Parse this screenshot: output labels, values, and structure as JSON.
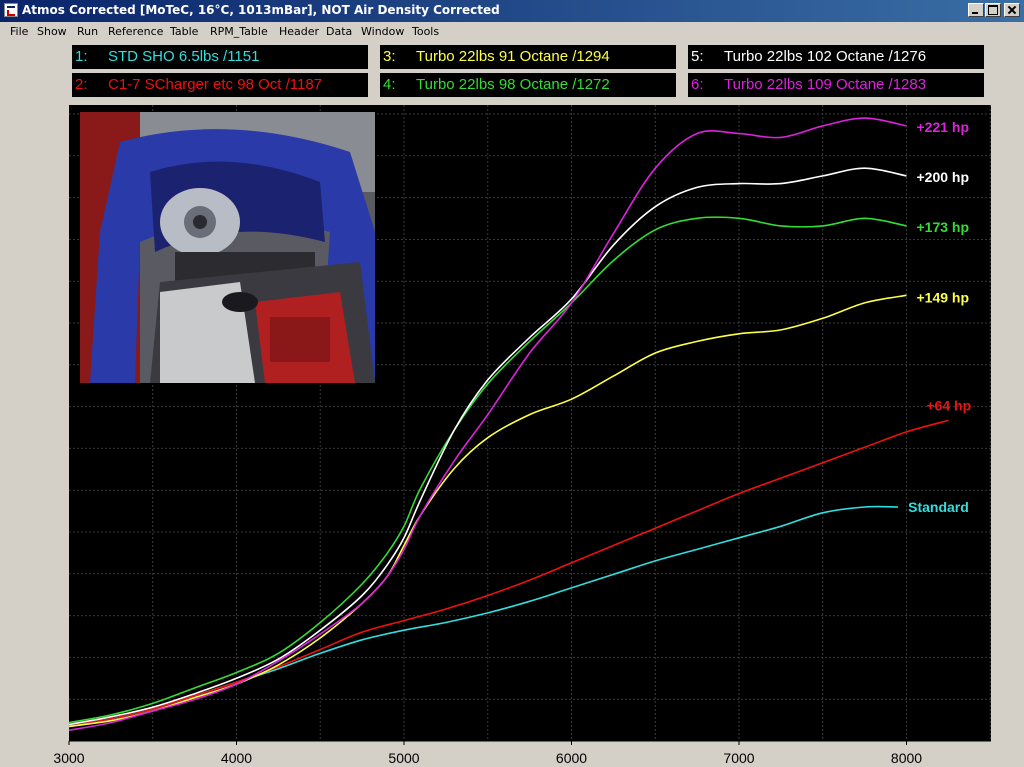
{
  "window": {
    "title": "Atmos Corrected [MoTeC, 16°C, 1013mBar], NOT Air Density Corrected"
  },
  "menu": {
    "items": [
      "File",
      "Show",
      "Run",
      "Reference",
      "Table",
      "RPM_Table",
      "Header",
      "Data",
      "Window",
      "Tools"
    ]
  },
  "legend": [
    {
      "num": "1:",
      "label": "STD SHO 6.5lbs /1151",
      "color": "#33dddd"
    },
    {
      "num": "2:",
      "label": "C1-7 SCharger etc 98 Oct /1187",
      "color": "#ee1111"
    },
    {
      "num": "3:",
      "label": "Turbo 22lbs 91 Octane /1294",
      "color": "#ffff44"
    },
    {
      "num": "4:",
      "label": "Turbo 22lbs 98 Octane /1272",
      "color": "#33dd33"
    },
    {
      "num": "5:",
      "label": "Turbo 22lbs 102 Octane /1276",
      "color": "#ffffff"
    },
    {
      "num": "6:",
      "label": "Turbo 22lbs 109 Octane /1283",
      "color": "#dd22dd"
    }
  ],
  "chart_data": {
    "type": "line",
    "xlim": [
      3000,
      8500
    ],
    "ylim": [
      0,
      100
    ],
    "x_ticks": [
      3000,
      4000,
      5000,
      6000,
      7000,
      8000
    ],
    "grid": true,
    "series": [
      {
        "name": "STD SHO 6.5lbs /1151",
        "color": "#33dddd",
        "end_label": "Standard",
        "points": [
          [
            3000,
            3
          ],
          [
            3250,
            5
          ],
          [
            3500,
            7.5
          ],
          [
            3750,
            11
          ],
          [
            4000,
            14.5
          ],
          [
            4250,
            18
          ],
          [
            4500,
            22
          ],
          [
            4750,
            25.5
          ],
          [
            5000,
            28
          ],
          [
            5250,
            30
          ],
          [
            5500,
            32.5
          ],
          [
            5750,
            35.5
          ],
          [
            6000,
            39
          ],
          [
            6250,
            42.5
          ],
          [
            6500,
            46
          ],
          [
            6750,
            49
          ],
          [
            7000,
            52
          ],
          [
            7250,
            55
          ],
          [
            7500,
            58.5
          ],
          [
            7750,
            60
          ],
          [
            7950,
            60
          ]
        ]
      },
      {
        "name": "C1-7 SCharger etc 98 Oct /1187",
        "color": "#ee1111",
        "end_label": "+64 hp",
        "points": [
          [
            3000,
            3
          ],
          [
            3250,
            5
          ],
          [
            3500,
            7.5
          ],
          [
            3750,
            11
          ],
          [
            4000,
            14.5
          ],
          [
            4250,
            18.5
          ],
          [
            4500,
            23
          ],
          [
            4750,
            27.5
          ],
          [
            5000,
            30.5
          ],
          [
            5250,
            33.5
          ],
          [
            5500,
            37
          ],
          [
            5750,
            41
          ],
          [
            6000,
            45.5
          ],
          [
            6250,
            50
          ],
          [
            6500,
            54.5
          ],
          [
            6750,
            59
          ],
          [
            7000,
            63.5
          ],
          [
            7250,
            67.5
          ],
          [
            7500,
            71.5
          ],
          [
            7750,
            75.5
          ],
          [
            8000,
            79.5
          ],
          [
            8250,
            82.5
          ]
        ]
      },
      {
        "name": "Turbo 22lbs 91 Octane /1294",
        "color": "#ffff44",
        "end_label": "+149 hp",
        "points": [
          [
            3000,
            3
          ],
          [
            3250,
            4.5
          ],
          [
            3500,
            7
          ],
          [
            3750,
            10.5
          ],
          [
            4000,
            14
          ],
          [
            4250,
            19
          ],
          [
            4500,
            26
          ],
          [
            4750,
            35
          ],
          [
            4900,
            42
          ],
          [
            5000,
            50
          ],
          [
            5100,
            58
          ],
          [
            5300,
            70
          ],
          [
            5500,
            78
          ],
          [
            5750,
            84
          ],
          [
            6000,
            88
          ],
          [
            6250,
            94
          ],
          [
            6500,
            100
          ],
          [
            6750,
            103
          ],
          [
            7000,
            105
          ],
          [
            7250,
            106
          ],
          [
            7500,
            109
          ],
          [
            7750,
            113
          ],
          [
            8000,
            115
          ]
        ]
      },
      {
        "name": "Turbo 22lbs 98 Octane /1272",
        "color": "#33dd33",
        "end_label": "+173 hp",
        "points": [
          [
            3000,
            4
          ],
          [
            3250,
            6
          ],
          [
            3500,
            9
          ],
          [
            3750,
            13
          ],
          [
            4000,
            17
          ],
          [
            4250,
            22
          ],
          [
            4500,
            30
          ],
          [
            4750,
            40
          ],
          [
            4900,
            48
          ],
          [
            5000,
            55
          ],
          [
            5100,
            65
          ],
          [
            5300,
            80
          ],
          [
            5500,
            92
          ],
          [
            5750,
            103
          ],
          [
            6000,
            113
          ],
          [
            6250,
            124
          ],
          [
            6500,
            132
          ],
          [
            6750,
            135
          ],
          [
            7000,
            135
          ],
          [
            7250,
            133
          ],
          [
            7500,
            133
          ],
          [
            7750,
            135
          ],
          [
            8000,
            133
          ]
        ]
      },
      {
        "name": "Turbo 22lbs 102 Octane /1276",
        "color": "#ffffff",
        "end_label": "+200 hp",
        "points": [
          [
            3000,
            3.5
          ],
          [
            3250,
            5.5
          ],
          [
            3500,
            8
          ],
          [
            3750,
            11.5
          ],
          [
            4000,
            15.5
          ],
          [
            4250,
            20.5
          ],
          [
            4500,
            28
          ],
          [
            4750,
            37
          ],
          [
            4900,
            45
          ],
          [
            5000,
            52
          ],
          [
            5100,
            62
          ],
          [
            5300,
            80
          ],
          [
            5500,
            93
          ],
          [
            5750,
            104
          ],
          [
            6000,
            114
          ],
          [
            6250,
            128
          ],
          [
            6500,
            138
          ],
          [
            6750,
            143
          ],
          [
            7000,
            144
          ],
          [
            7250,
            144
          ],
          [
            7500,
            146
          ],
          [
            7750,
            148
          ],
          [
            8000,
            146
          ]
        ]
      },
      {
        "name": "Turbo 22lbs 109 Octane /1283",
        "color": "#dd22dd",
        "end_label": "+221 hp",
        "points": [
          [
            3000,
            2
          ],
          [
            3250,
            4
          ],
          [
            3500,
            7
          ],
          [
            3750,
            10
          ],
          [
            4000,
            14
          ],
          [
            4250,
            20
          ],
          [
            4500,
            27
          ],
          [
            4750,
            35
          ],
          [
            4900,
            42
          ],
          [
            5000,
            49
          ],
          [
            5100,
            58
          ],
          [
            5300,
            72
          ],
          [
            5500,
            84
          ],
          [
            5750,
            100
          ],
          [
            6000,
            113
          ],
          [
            6250,
            131
          ],
          [
            6500,
            148
          ],
          [
            6750,
            157
          ],
          [
            7000,
            157
          ],
          [
            7250,
            156
          ],
          [
            7500,
            159
          ],
          [
            7750,
            161
          ],
          [
            8000,
            159
          ]
        ]
      }
    ]
  }
}
